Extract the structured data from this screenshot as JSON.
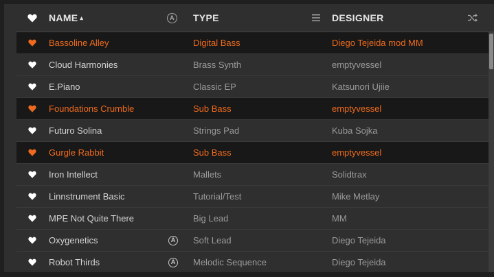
{
  "header": {
    "name_label": "NAME",
    "sort_indicator": "▴",
    "type_label": "TYPE",
    "designer_label": "DESIGNER",
    "badge_letter": "A",
    "icons": [
      "heart-icon",
      "arturia-badge-icon",
      "menu-icon",
      "shuffle-icon"
    ]
  },
  "colors": {
    "accent": "#ee6a1e",
    "background": "#2f2f2f",
    "selected_background": "#181818"
  },
  "presets": [
    {
      "name": "Bassoline Alley",
      "type": "Digital Bass",
      "designer": "Diego Tejeida mod MM",
      "liked": true,
      "badge": false
    },
    {
      "name": "Cloud Harmonies",
      "type": "Brass Synth",
      "designer": "emptyvessel",
      "liked": false,
      "badge": false
    },
    {
      "name": "E.Piano",
      "type": "Classic EP",
      "designer": "Katsunori Ujiie",
      "liked": false,
      "badge": false
    },
    {
      "name": "Foundations Crumble",
      "type": "Sub Bass",
      "designer": "emptyvessel",
      "liked": true,
      "badge": false
    },
    {
      "name": "Futuro Solina",
      "type": "Strings Pad",
      "designer": "Kuba Sojka",
      "liked": false,
      "badge": false
    },
    {
      "name": "Gurgle Rabbit",
      "type": "Sub Bass",
      "designer": "emptyvessel",
      "liked": true,
      "badge": false
    },
    {
      "name": "Iron Intellect",
      "type": "Mallets",
      "designer": "Solidtrax",
      "liked": false,
      "badge": false
    },
    {
      "name": "Linnstrument Basic",
      "type": "Tutorial/Test",
      "designer": "Mike Metlay",
      "liked": false,
      "badge": false
    },
    {
      "name": "MPE Not Quite There",
      "type": "Big Lead",
      "designer": "MM",
      "liked": false,
      "badge": false
    },
    {
      "name": "Oxygenetics",
      "type": "Soft Lead",
      "designer": "Diego Tejeida",
      "liked": false,
      "badge": true
    },
    {
      "name": "Robot Thirds",
      "type": "Melodic Sequence",
      "designer": "Diego Tejeida",
      "liked": false,
      "badge": true
    }
  ]
}
